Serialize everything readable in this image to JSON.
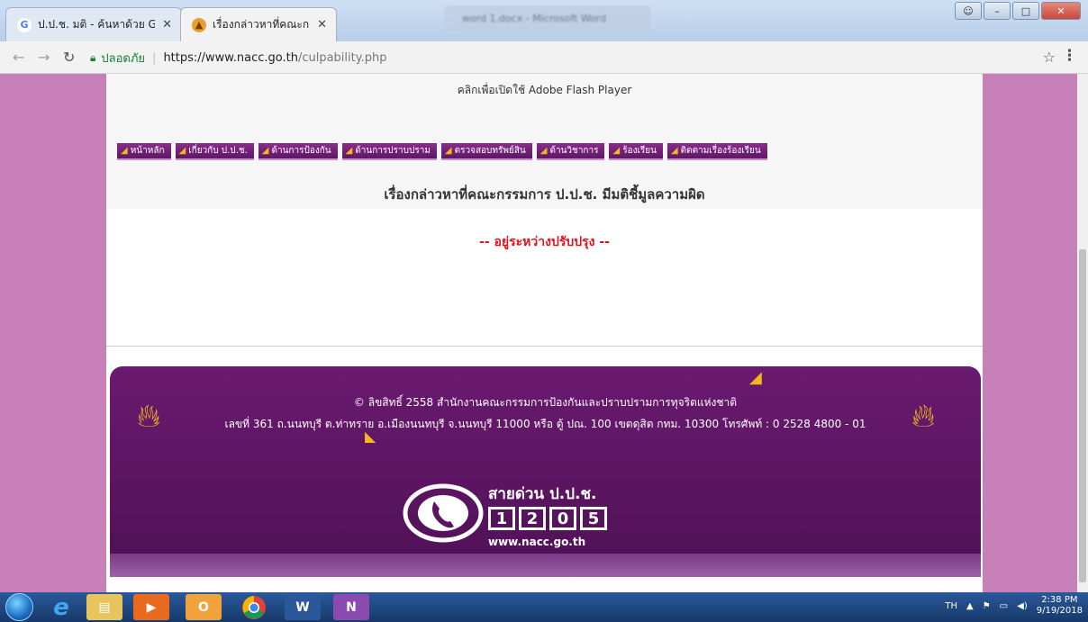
{
  "browser": {
    "tabs": [
      {
        "title": "ป.ป.ช. มติ - ค้นหาด้วย Goog",
        "favicon": "google-icon"
      },
      {
        "title": "เรื่องกล่าวหาที่คณะกรรมกา",
        "favicon": "nacc-emblem-icon"
      }
    ],
    "background_window_title": "word 1.docx - Microsoft Word",
    "address": {
      "secure_label": "ปลอดภัย",
      "host": "https://www.nacc.go.th",
      "path": "/culpability.php"
    }
  },
  "page": {
    "flash_prompt": "คลิกเพื่อเปิดใช้ Adobe Flash Player",
    "menu": [
      "หน้าหลัก",
      "เกี่ยวกับ ป.ป.ช.",
      "ด้านการป้องกัน",
      "ด้านการปราบปราม",
      "ตรวจสอบทรัพย์สิน",
      "ด้านวิชาการ",
      "ร้องเรียน",
      "ติดตามเรื่องร้องเรียน"
    ],
    "heading": "เรื่องกล่าวหาที่คณะกรรมการ ป.ป.ช. มีมติชี้มูลความผิด",
    "status": "-- อยู่ระหว่างปรับปรุง --",
    "footer": {
      "copyright": "© ลิขสิทธิ์ 2558 สำนักงานคณะกรรมการป้องกันและปราบปรามการทุจริตแห่งชาติ",
      "address": "เลขที่ 361 ถ.นนทบุรี ต.ท่าทราย อ.เมืองนนทบุรี จ.นนทบุรี 11000 หรือ ตู้ ปณ. 100 เขตดุสิต กทม. 10300 โทรศัพท์ : 0 2528 4800 - 01",
      "hotline_title": "สายด่วน ป.ป.ช.",
      "hotline_digits": [
        "1",
        "2",
        "0",
        "5"
      ],
      "hotline_url": "www.nacc.go.th"
    }
  },
  "taskbar": {
    "language": "TH",
    "time": "2:38 PM",
    "date": "9/19/2018"
  },
  "colors": {
    "menu_bg": "#6b1f72",
    "footer_bg": "#5a1460",
    "page_side": "#c880b8",
    "status_red": "#e0141e",
    "flame": "#f3b81d"
  }
}
